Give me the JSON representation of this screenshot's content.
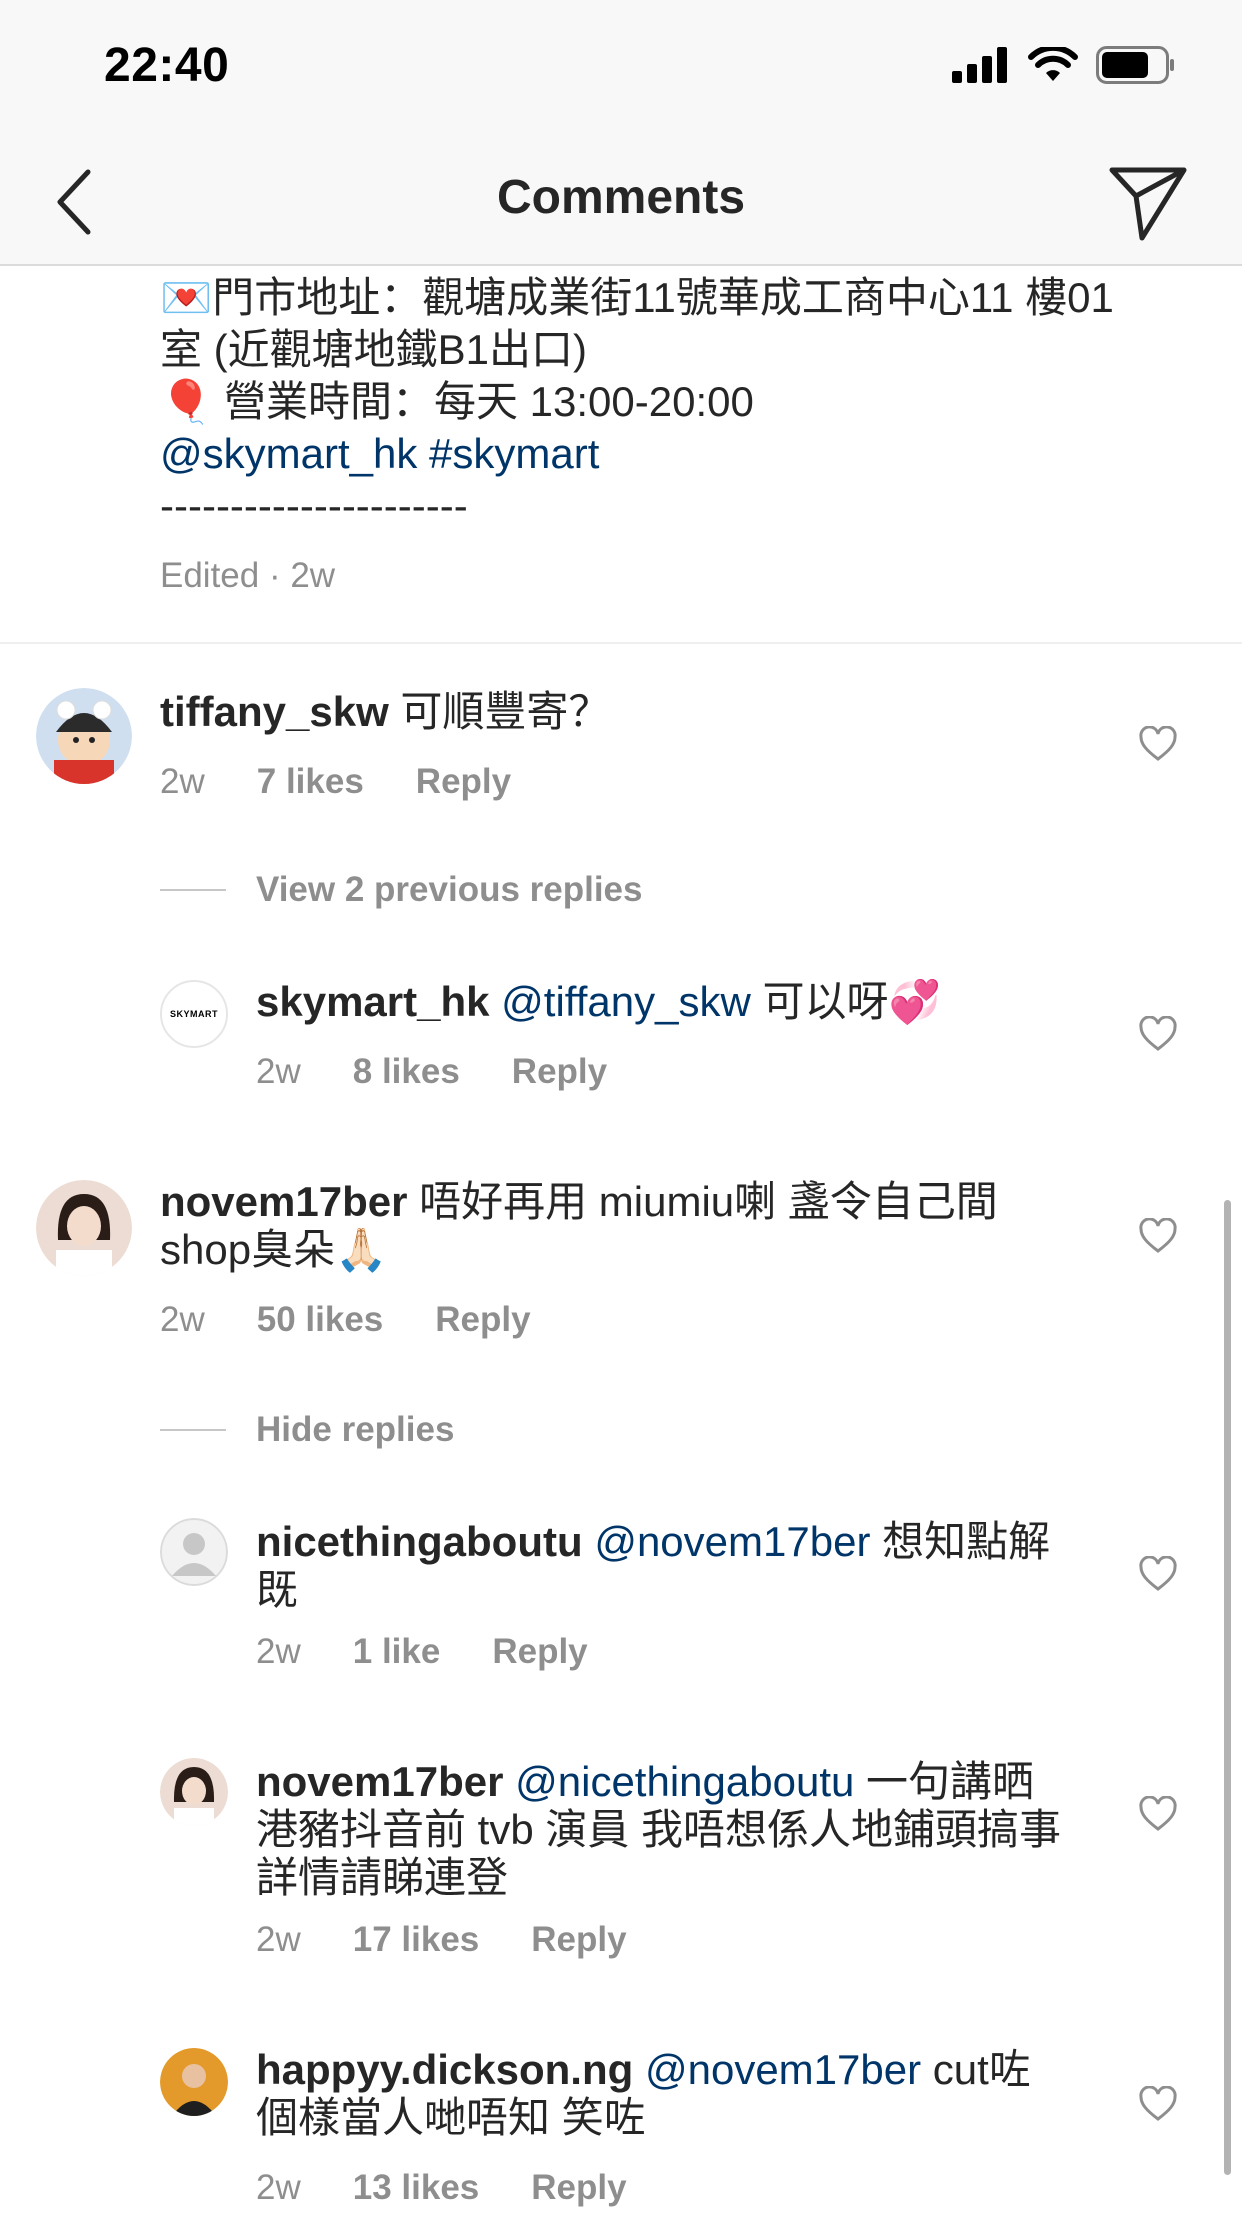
{
  "status": {
    "time": "22:40"
  },
  "nav": {
    "title": "Comments"
  },
  "caption": {
    "line1_icon": "💌",
    "line1": "門市地址：觀塘成業街11號華成工商中心11 樓01",
    "line2": "室 (近觀塘地鐵B1出口)",
    "line3_icon": "🎈",
    "line3": " 營業時間：每天 13:00-20:00",
    "mention": "@skymart_hk",
    "hashtag": "#skymart",
    "dashes": "----------------------",
    "meta": "Edited · 2w"
  },
  "comments": [
    {
      "user": "tiffany_skw",
      "text": " 可順豐寄？",
      "time": "2w",
      "likes": "7 likes",
      "reply": "Reply"
    },
    {
      "user": "skymart_hk",
      "mention": "@tiffany_skw",
      "text": " 可以呀💞",
      "time": "2w",
      "likes": "8 likes",
      "reply": "Reply"
    },
    {
      "user": "novem17ber",
      "text": " 唔好再用 miumiu喇 盞令自己間",
      "text2": "shop臭朵🙏🏻",
      "time": "2w",
      "likes": "50 likes",
      "reply": "Reply"
    },
    {
      "user": "nicethingaboutu",
      "mention": "@novem17ber",
      "text": " 想知點解",
      "text2": "既",
      "time": "2w",
      "likes": "1 like",
      "reply": "Reply"
    },
    {
      "user": "novem17ber",
      "mention": "@nicethingaboutu",
      "text": " 一句講晒",
      "text2": "港豬抖音前 tvb 演員 我唔想係人地鋪頭搞事",
      "text3": "詳情請睇連登",
      "time": "2w",
      "likes": "17 likes",
      "reply": "Reply"
    },
    {
      "user": "happyy.dickson.ng",
      "mention": "@novem17ber",
      "text": " cut咗",
      "text2": "個樣當人哋唔知 笑咗",
      "time": "2w",
      "likes": "13 likes",
      "reply": "Reply"
    }
  ],
  "thread": {
    "view_previous": "View 2 previous replies",
    "hide": "Hide replies"
  },
  "avatar_text": {
    "skymart": "SKYMART"
  },
  "colors": {
    "link": "#003569",
    "muted": "#8e8e8e",
    "text": "#262626"
  }
}
